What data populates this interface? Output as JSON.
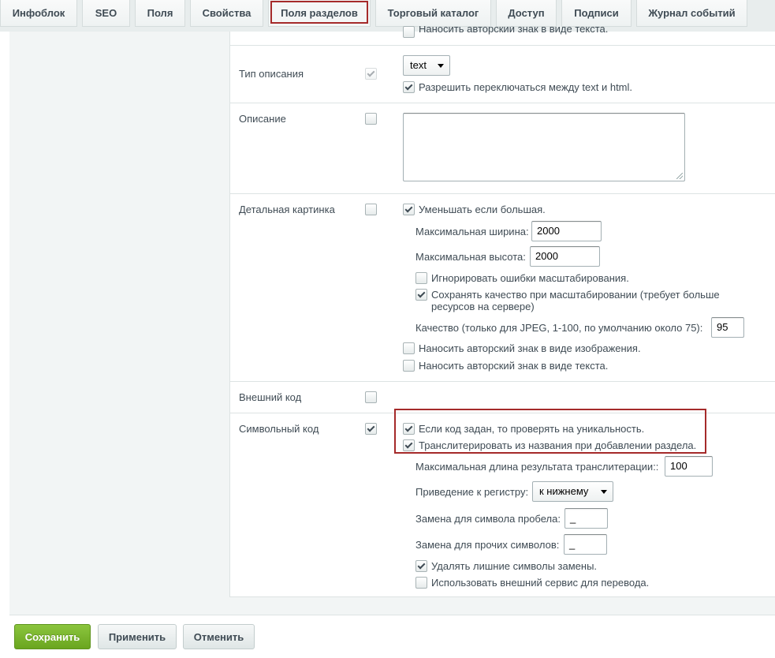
{
  "tabs": [
    {
      "label": "Инфоблок"
    },
    {
      "label": "SEO"
    },
    {
      "label": "Поля"
    },
    {
      "label": "Свойства"
    },
    {
      "label": "Поля разделов"
    },
    {
      "label": "Торговый каталог"
    },
    {
      "label": "Доступ"
    },
    {
      "label": "Подписи"
    },
    {
      "label": "Журнал событий"
    }
  ],
  "active_tab": "Поля разделов",
  "top_cut_text": "Наносить авторский знак в виде текста.",
  "rows": {
    "description_type": {
      "label": "Тип описания",
      "select_value": "text",
      "allow_switch_label": "Разрешить переключаться между text и html."
    },
    "description": {
      "label": "Описание"
    },
    "detail_picture": {
      "label": "Детальная картинка",
      "scale_label": "Уменьшать если большая.",
      "max_width_label": "Максимальная ширина:",
      "max_width_value": "2000",
      "max_height_label": "Максимальная высота:",
      "max_height_value": "2000",
      "ignore_errors_label": "Игнорировать ошибки масштабирования.",
      "keep_quality_label_1": "Сохранять качество при масштабировании (требует больше",
      "keep_quality_label_2": "ресурсов на сервере)",
      "quality_label": "Качество (только для JPEG, 1-100, по умолчанию около 75):",
      "quality_value": "95",
      "watermark_image_label": "Наносить авторский знак в виде изображения.",
      "watermark_text_label": "Наносить авторский знак в виде текста."
    },
    "xml_id": {
      "label": "Внешний код"
    },
    "code": {
      "label": "Символьный код",
      "unique_label": "Если код задан, то проверять на уникальность.",
      "transliterate_label": "Транслитерировать из названия при добавлении раздела.",
      "max_len_label": "Максимальная длина результата транслитерации::",
      "max_len_value": "100",
      "case_label": "Приведение к регистру:",
      "case_value": "к нижнему",
      "space_label": "Замена для символа пробела:",
      "space_value": "_",
      "other_label": "Замена для прочих символов:",
      "other_value": "_",
      "remove_extra_label": "Удалять лишние символы замены.",
      "external_service_label": "Использовать внешний сервис для перевода."
    }
  },
  "buttons": {
    "save": "Сохранить",
    "apply": "Применить",
    "cancel": "Отменить"
  },
  "colors": {
    "highlight": "#a52a2a",
    "save_button": "#7ab72f"
  }
}
